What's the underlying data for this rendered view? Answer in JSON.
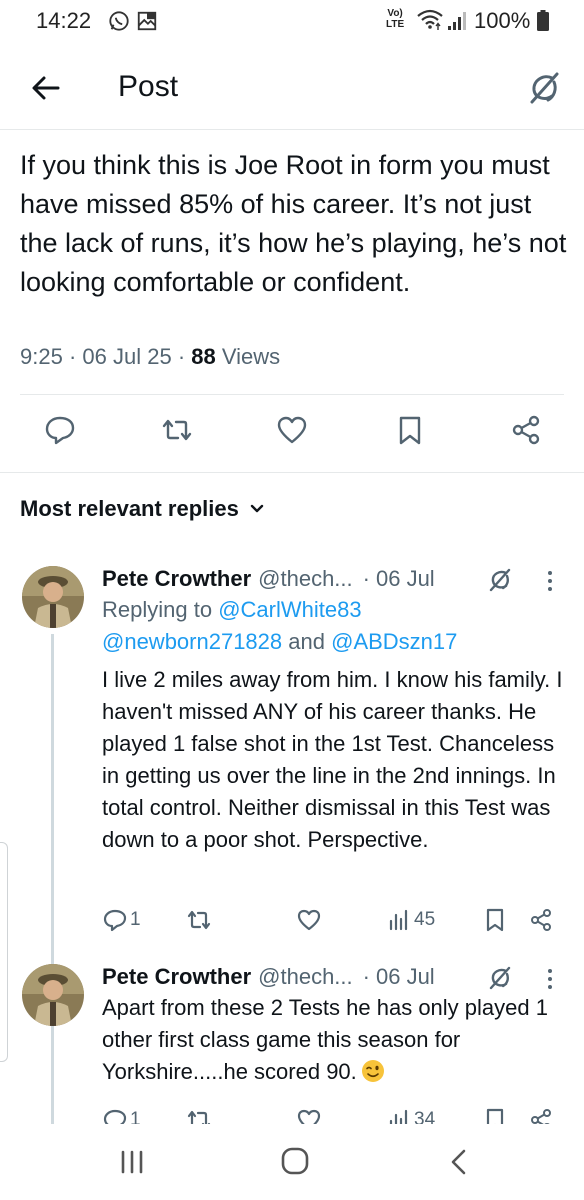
{
  "status_bar": {
    "time": "14:22",
    "lte_top": "Vo)",
    "lte_bottom": "LTE",
    "battery": "100%"
  },
  "header": {
    "title": "Post"
  },
  "post": {
    "text": "If you think this is Joe Root in form you must have missed 85% of his career. It’s not just the lack of runs, it’s how he’s playing, he’s not looking comfortable or confident.",
    "time": "9:25",
    "date": "06 Jul 25",
    "views_count": "88",
    "views_label": "Views",
    "sep": "·"
  },
  "replies_header": {
    "label": "Most relevant replies"
  },
  "replies": [
    {
      "name": "Pete Crowther",
      "handle": "@thech...",
      "date": "06 Jul",
      "replying_prefix": "Replying to",
      "replying_1": "@CarlWhite83",
      "replying_2": "@newborn271828",
      "replying_and": "and",
      "replying_3": "@ABDszn17",
      "text": "I live 2 miles away from him. I know his family. I haven't missed ANY of his career thanks. He played 1 false shot in the 1st Test. Chanceless in getting us over the line in the 2nd innings. In total control. Neither dismissal in this Test was down to a poor shot. Perspective.",
      "reply_count": "1",
      "views": "45"
    },
    {
      "name": "Pete Crowther",
      "handle": "@thech...",
      "date": "06 Jul",
      "text": "Apart from these 2 Tests he has only played 1 other first class game this season for Yorkshire.....he scored 90.",
      "emoji": "winking-face",
      "reply_count": "1",
      "views": "34"
    }
  ],
  "colors": {
    "text": "#0f1419",
    "secondary": "#536471",
    "link": "#1d9bf0",
    "divider": "#e6e9ea"
  }
}
